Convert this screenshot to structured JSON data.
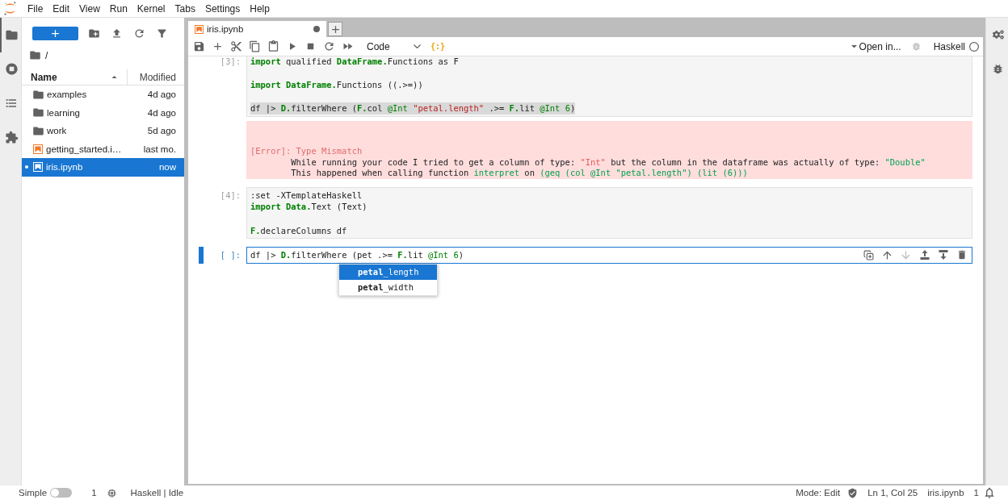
{
  "menu_bar": {
    "items": [
      "File",
      "Edit",
      "View",
      "Run",
      "Kernel",
      "Tabs",
      "Settings",
      "Help"
    ]
  },
  "left_sidebar": {
    "tabs": [
      {
        "kind": "files",
        "selected": true
      },
      {
        "kind": "running",
        "selected": false
      },
      {
        "kind": "toc",
        "selected": false
      },
      {
        "kind": "extensions",
        "selected": false
      }
    ]
  },
  "file_browser": {
    "breadcrumb": "/",
    "columns": [
      {
        "label": "Name",
        "sorted": true
      },
      {
        "label": "Modified",
        "sorted": false
      }
    ],
    "items": [
      {
        "kind": "folder",
        "name": "examples",
        "modified": "4d ago",
        "selected": false,
        "running": false
      },
      {
        "kind": "folder",
        "name": "learning",
        "modified": "4d ago",
        "selected": false,
        "running": false
      },
      {
        "kind": "folder",
        "name": "work",
        "modified": "5d ago",
        "selected": false,
        "running": false
      },
      {
        "kind": "notebook",
        "name": "getting_started.i…",
        "modified": "last mo.",
        "selected": false,
        "running": false
      },
      {
        "kind": "notebook",
        "name": "iris.ipynb",
        "modified": "now",
        "selected": true,
        "running": true
      }
    ]
  },
  "tab_bar": {
    "tabs": [
      {
        "label": "iris.ipynb",
        "selected": true,
        "dirty": true
      }
    ]
  },
  "notebook": {
    "toolbar": {
      "cell_type": "Code",
      "format_button": "{:}",
      "open_in": "Open in...",
      "debugger_disabled": true,
      "kernel": "Haskell",
      "kernel_busy": false
    },
    "cells": [
      {
        "prompt": "[3]:",
        "active": false,
        "lines": [
          {
            "highlighted": false,
            "tokens": [
              {
                "kind": "keyword",
                "text": "import"
              },
              {
                "kind": "plain",
                "text": " qualified "
              },
              {
                "kind": "module",
                "text": "DataFrame."
              },
              {
                "kind": "plain",
                "text": "Functions as F"
              }
            ]
          },
          {
            "highlighted": false
          },
          {
            "highlighted": false,
            "tokens": [
              {
                "kind": "keyword",
                "text": "import "
              },
              {
                "kind": "module",
                "text": "DataFrame."
              },
              {
                "kind": "plain",
                "text": "Functions ((.>=))"
              }
            ]
          },
          {
            "highlighted": false
          },
          {
            "highlighted": true,
            "tokens": [
              {
                "kind": "plain",
                "text": "df |> "
              },
              {
                "kind": "module",
                "text": "D."
              },
              {
                "kind": "plain",
                "text": "filterWhere ("
              },
              {
                "kind": "module",
                "text": "F."
              },
              {
                "kind": "plain",
                "text": "col "
              },
              {
                "kind": "type",
                "text": "@Int "
              },
              {
                "kind": "string",
                "text": "\"petal.length\""
              },
              {
                "kind": "plain",
                "text": " .>= "
              },
              {
                "kind": "module",
                "text": "F."
              },
              {
                "kind": "plain",
                "text": "lit "
              },
              {
                "kind": "type",
                "text": "@Int "
              },
              {
                "kind": "number",
                "text": "6"
              },
              {
                "kind": "plain",
                "text": ")"
              }
            ]
          }
        ],
        "output": {
          "kind": "error",
          "lines": [
            {
              "indented": false,
              "tokens": [
                {
                  "kind": "error",
                  "text": "[Error]: Type Mismatch"
                }
              ]
            },
            {
              "indented": true,
              "tokens": [
                {
                  "kind": "plain",
                  "text": "While running your code I tried to get a column of type: "
                },
                {
                  "kind": "red",
                  "text": "\"Int\""
                },
                {
                  "kind": "plain",
                  "text": " but the column in the dataframe was actually of type: "
                },
                {
                  "kind": "green",
                  "text": "\"Double\""
                }
              ]
            },
            {
              "indented": true,
              "tokens": [
                {
                  "kind": "plain",
                  "text": "This happened when calling function "
                },
                {
                  "kind": "green",
                  "text": "interpret"
                },
                {
                  "kind": "plain",
                  "text": " on "
                },
                {
                  "kind": "green",
                  "text": "(geq (col @Int \"petal.length\") (lit (6)))"
                }
              ]
            }
          ]
        }
      },
      {
        "prompt": "[4]:",
        "active": false,
        "lines": [
          {
            "highlighted": false,
            "tokens": [
              {
                "kind": "plain",
                "text": ":set -XTemplateHaskell"
              }
            ]
          },
          {
            "highlighted": false,
            "tokens": [
              {
                "kind": "keyword",
                "text": "import "
              },
              {
                "kind": "module",
                "text": "Data."
              },
              {
                "kind": "plain",
                "text": "Text (Text)"
              }
            ]
          },
          {
            "highlighted": false
          },
          {
            "highlighted": false,
            "tokens": [
              {
                "kind": "module",
                "text": "F."
              },
              {
                "kind": "plain",
                "text": "declareColumns df"
              }
            ]
          }
        ]
      },
      {
        "prompt": "[ ]:",
        "active": true,
        "lines": [
          {
            "highlighted": false,
            "tokens": [
              {
                "kind": "plain",
                "text": "df |> "
              },
              {
                "kind": "module",
                "text": "D."
              },
              {
                "kind": "plain",
                "text": "filterWhere (pet .>= "
              },
              {
                "kind": "module",
                "text": "F."
              },
              {
                "kind": "plain",
                "text": "lit "
              },
              {
                "kind": "type",
                "text": "@Int "
              },
              {
                "kind": "number",
                "text": "6"
              },
              {
                "kind": "plain",
                "text": ")"
              }
            ]
          }
        ],
        "toolbar": [
          {
            "kind": "duplicate",
            "disabled": false
          },
          {
            "kind": "move_up",
            "disabled": false
          },
          {
            "kind": "move_down",
            "disabled": true
          },
          {
            "kind": "insert_above",
            "disabled": false
          },
          {
            "kind": "insert_below",
            "disabled": false
          },
          {
            "kind": "delete",
            "disabled": false
          }
        ],
        "completer": {
          "items": [
            {
              "label": "**petal**_length",
              "selected": true
            },
            {
              "label": "**petal**_width",
              "selected": false
            }
          ]
        }
      }
    ]
  },
  "right_sidebar": {
    "tabs": [
      {
        "kind": "property_inspector",
        "selected": false
      },
      {
        "kind": "debugger",
        "selected": false
      }
    ]
  },
  "status_bar": {
    "simple_mode": {
      "label": "Simple",
      "on": false
    },
    "terminals": "1",
    "kernel_status": "Haskell | Idle",
    "mode": "Mode: Edit",
    "cursor": "Ln 1, Col 25",
    "file": "iris.ipynb",
    "notifications": "1"
  }
}
